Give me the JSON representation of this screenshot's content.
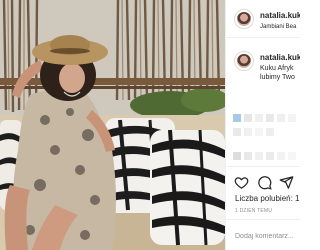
{
  "post": {
    "username": "natalia.kuk",
    "location": "Jambiani Bea",
    "caption_line1": "Kuku Afryk",
    "caption_line2": "lubimy Two"
  },
  "actions": {
    "likes_label": "Liczba polubień: 1",
    "time_label": "1 DZIEŃ TEMU",
    "comment_placeholder": "Dodaj komentarz..."
  },
  "icons": {
    "like": "heart-icon",
    "comment": "comment-icon",
    "share": "share-icon"
  },
  "colors": {
    "text": "#262626",
    "muted": "#8e8e8e",
    "divider": "#efefef"
  }
}
